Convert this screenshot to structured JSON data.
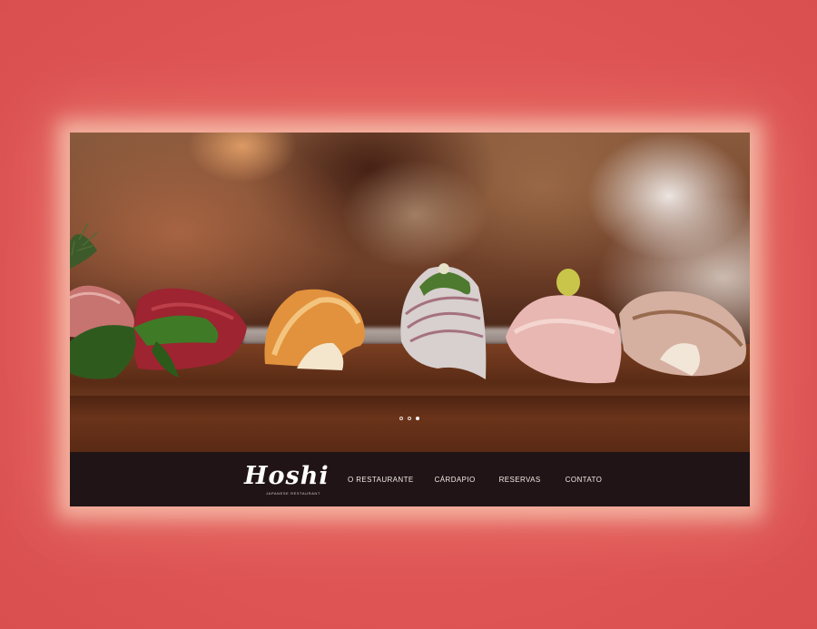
{
  "brand": {
    "name": "Hoshi",
    "tagline": "JAPANESE RESTAURANT"
  },
  "nav": {
    "items": [
      {
        "label": "O RESTAURANTE"
      },
      {
        "label": "CÁRDAPIO"
      },
      {
        "label": "RESERVAS"
      },
      {
        "label": "CONTATO"
      }
    ]
  },
  "slider": {
    "slide_count": 3,
    "active_index": 2
  },
  "colors": {
    "page_background": "#e05656",
    "navbar_background": "#201416",
    "nav_text": "#f3ece6"
  }
}
